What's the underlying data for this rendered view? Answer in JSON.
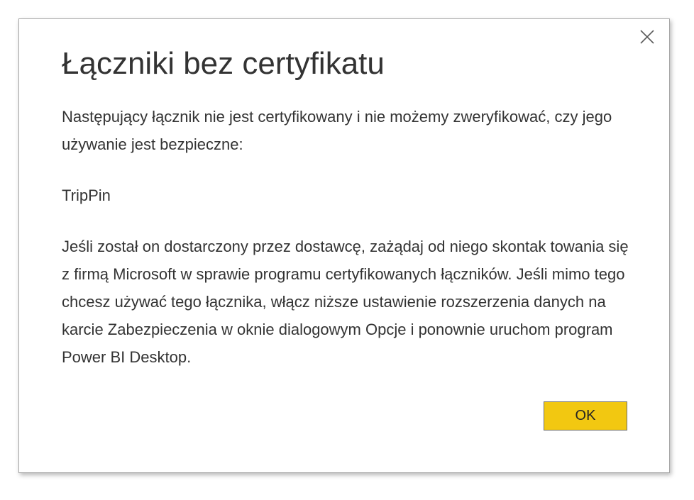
{
  "dialog": {
    "title": "Łączniki bez certyfikatu",
    "intro_text": "Następujący łącznik nie jest certyfikowany i nie możemy zweryfikować, czy jego używanie jest bezpieczne:",
    "connector_name": "TripPin",
    "body_text": "Jeśli został on dostarczony przez dostawcę, zażądaj od niego skontak towania się z firmą Microsoft w sprawie programu certyfikowanych łączników. Jeśli mimo tego chcesz używać tego łącznika, włącz niższe ustawienie rozszerzenia danych na karcie Zabezpieczenia w oknie dialogowym Opcje i ponownie uruchom program Power BI Desktop.",
    "ok_label": "OK",
    "close_icon": "close-icon"
  },
  "colors": {
    "ok_button_background": "#f2c811",
    "text": "#333333",
    "dialog_border": "#a6a6a6"
  }
}
